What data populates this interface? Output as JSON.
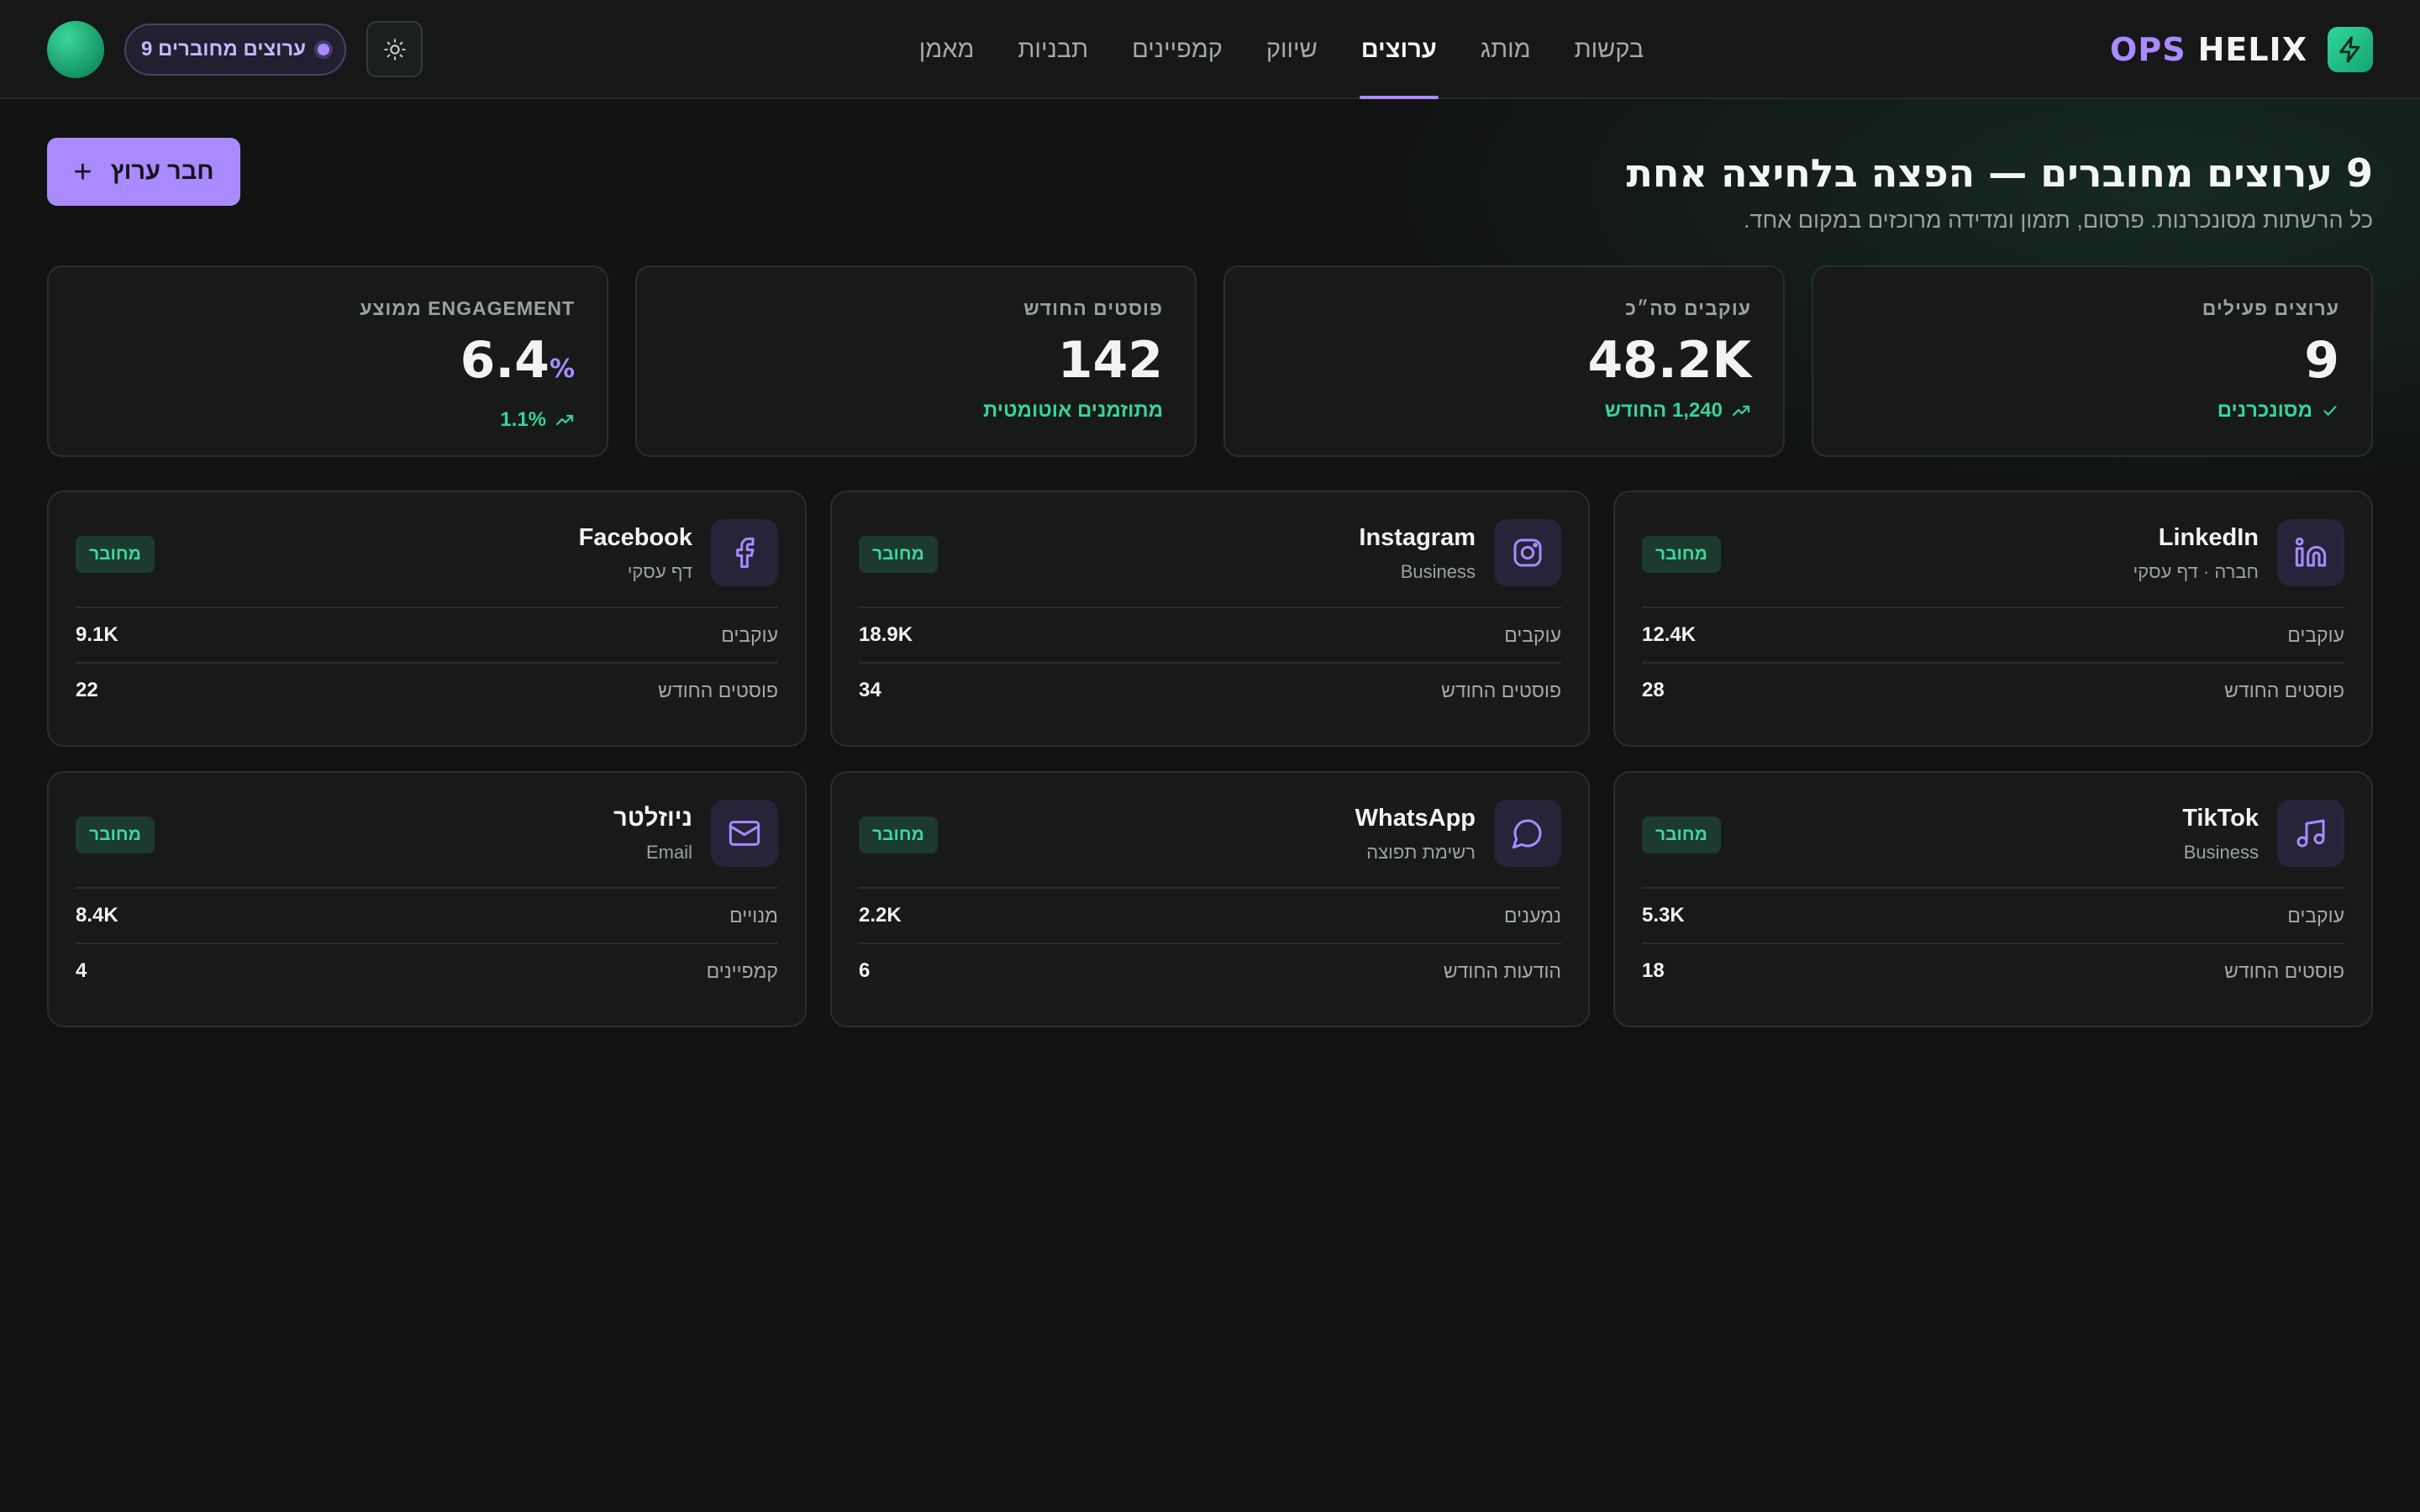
{
  "brand": {
    "ops": "OPS",
    "helix": "HELIX"
  },
  "nav": [
    {
      "label": "בקשות"
    },
    {
      "label": "מותג"
    },
    {
      "label": "ערוצים",
      "active": true
    },
    {
      "label": "שיווק"
    },
    {
      "label": "קמפיינים"
    },
    {
      "label": "תבניות"
    },
    {
      "label": "מאמן"
    }
  ],
  "status_pill": "9 ערוצים מחוברים",
  "header": {
    "title": "9 ערוצים מחוברים — הפצה בלחיצה אחת",
    "subtitle": "כל הרשתות מסונכרנות. פרסום, תזמון ומדידה מרוכזים במקום אחד."
  },
  "connect_button": {
    "label": "חבר ערוץ",
    "plus": "+"
  },
  "stats": [
    {
      "label": "ערוצים פעילים",
      "value": "9",
      "unit": "",
      "note": "מסונכרנים",
      "icon": "check-icon"
    },
    {
      "label": "עוקבים סה״כ",
      "value": "48.2K",
      "unit": "",
      "note": "1,240 החודש",
      "icon": "trend-up-icon"
    },
    {
      "label": "פוסטים החודש",
      "value": "142",
      "unit": "",
      "note": "מתוזמנים אוטומטית",
      "icon": ""
    },
    {
      "label": "ENGAGEMENT ממוצע",
      "value": "6.4",
      "unit": "%",
      "note": "1.1%",
      "icon": "trend-up-icon"
    }
  ],
  "platforms": [
    {
      "name": "LinkedIn",
      "sub": "חברה · דף עסקי",
      "badge": "מחובר",
      "icon": "linkedin-icon",
      "rows": [
        {
          "k": "עוקבים",
          "v": "12.4K"
        },
        {
          "k": "פוסטים החודש",
          "v": "28"
        }
      ]
    },
    {
      "name": "Instagram",
      "sub": "Business",
      "badge": "מחובר",
      "icon": "instagram-icon",
      "rows": [
        {
          "k": "עוקבים",
          "v": "18.9K"
        },
        {
          "k": "פוסטים החודש",
          "v": "34"
        }
      ]
    },
    {
      "name": "Facebook",
      "sub": "דף עסקי",
      "badge": "מחובר",
      "icon": "facebook-icon",
      "rows": [
        {
          "k": "עוקבים",
          "v": "9.1K"
        },
        {
          "k": "פוסטים החודש",
          "v": "22"
        }
      ]
    },
    {
      "name": "TikTok",
      "sub": "Business",
      "badge": "מחובר",
      "icon": "music-note-icon",
      "rows": [
        {
          "k": "עוקבים",
          "v": "5.3K"
        },
        {
          "k": "פוסטים החודש",
          "v": "18"
        }
      ]
    },
    {
      "name": "WhatsApp",
      "sub": "רשימת תפוצה",
      "badge": "מחובר",
      "icon": "chat-bubble-icon",
      "rows": [
        {
          "k": "נמענים",
          "v": "2.2K"
        },
        {
          "k": "הודעות החודש",
          "v": "6"
        }
      ]
    },
    {
      "name": "ניוזלטר",
      "sub": "Email",
      "badge": "מחובר",
      "icon": "mail-icon",
      "rows": [
        {
          "k": "מנויים",
          "v": "8.4K"
        },
        {
          "k": "קמפיינים",
          "v": "4"
        }
      ]
    }
  ],
  "colors": {
    "accent": "#a98bff",
    "success": "#37d39a",
    "bg": "#111313",
    "card": "#181a1a"
  }
}
